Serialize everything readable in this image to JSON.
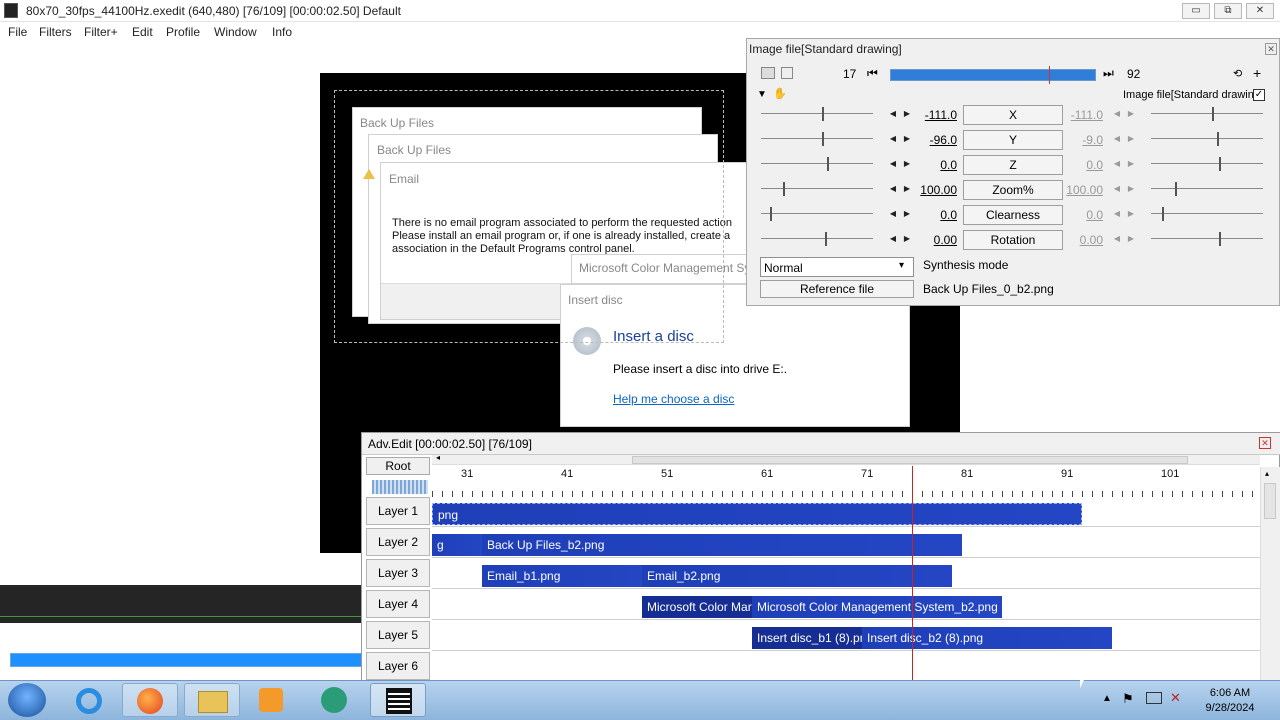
{
  "window": {
    "title": "80x70_30fps_44100Hz.exedit (640,480)  [76/109] [00:00:02.50]  Default",
    "min": "▭",
    "max": "⧉",
    "close": "✕"
  },
  "menu": [
    "File",
    "Filters",
    "Filter+",
    "Edit",
    "Profile",
    "Window",
    "Info"
  ],
  "preview": {
    "dialogs": {
      "backup1": "Back Up Files",
      "backup2": "Back Up Files",
      "email_title": "Email",
      "email_body": [
        "There is no email program associated to perform the requested action",
        "Please install an email program or, if one is already installed, create a",
        "association in the Default Programs control panel."
      ],
      "color_mgmt": "Microsoft Color Management Sy",
      "insert_title": "Insert disc",
      "insert_heading": "Insert a disc",
      "insert_body": "Please insert a disc into drive E:.",
      "insert_link": "Help me choose a disc"
    }
  },
  "properties": {
    "title": "Image file[Standard drawing]",
    "frame_start": "17",
    "frame_end": "92",
    "object_label": "Image file[Standard drawing]",
    "rows": [
      {
        "name": "X",
        "value": "-111.0",
        "end": "-111.0",
        "pos": 0.55,
        "pos2": 0.55
      },
      {
        "name": "Y",
        "value": "-96.0",
        "end": "-9.0",
        "pos": 0.55,
        "pos2": 0.6
      },
      {
        "name": "Z",
        "value": "0.0",
        "end": "0.0",
        "pos": 0.6,
        "pos2": 0.62
      },
      {
        "name": "Zoom%",
        "value": "100.00",
        "end": "100.00",
        "pos": 0.2,
        "pos2": 0.22
      },
      {
        "name": "Clearness",
        "value": "0.0",
        "end": "0.0",
        "pos": 0.08,
        "pos2": 0.1
      },
      {
        "name": "Rotation",
        "value": "0.00",
        "end": "0.00",
        "pos": 0.58,
        "pos2": 0.62
      }
    ],
    "blend": "Normal",
    "blend_label": "Synthesis mode",
    "ref_button": "Reference file",
    "ref_file": "Back Up Files_0_b2.png"
  },
  "timeline": {
    "title": "Adv.Edit [00:00:02.50] [76/109]",
    "root": "Root",
    "ticks": [
      "31",
      "41",
      "51",
      "61",
      "71",
      "81",
      "91",
      "101"
    ],
    "layers": [
      "Layer 1",
      "Layer 2",
      "Layer 3",
      "Layer 4",
      "Layer 5",
      "Layer 6"
    ],
    "clips": [
      {
        "layer": 0,
        "label": "png"
      },
      {
        "layer": 1,
        "label": "g"
      },
      {
        "layer": 1,
        "label": "Back Up Files_b2.png"
      },
      {
        "layer": 2,
        "label": "Email_b1.png"
      },
      {
        "layer": 2,
        "label": "Email_b2.png"
      },
      {
        "layer": 3,
        "label": "Microsoft Color Mar"
      },
      {
        "layer": 3,
        "label": "Microsoft Color Management System_b2.png"
      },
      {
        "layer": 4,
        "label": "Insert disc_b1 (8).pn"
      },
      {
        "layer": 4,
        "label": "Insert disc_b2 (8).png"
      }
    ]
  },
  "taskbar": {
    "time": "6:06 AM",
    "date": "9/28/2024",
    "apps": [
      "start-orb",
      "internet-explorer",
      "firefox",
      "file-explorer",
      "media-player",
      "browser",
      "aviutl"
    ]
  },
  "colors": {
    "clip": "#1f3fb8",
    "clip_dark": "#162e94",
    "cursor": "#cc2222",
    "accent": "#1e90ff"
  }
}
